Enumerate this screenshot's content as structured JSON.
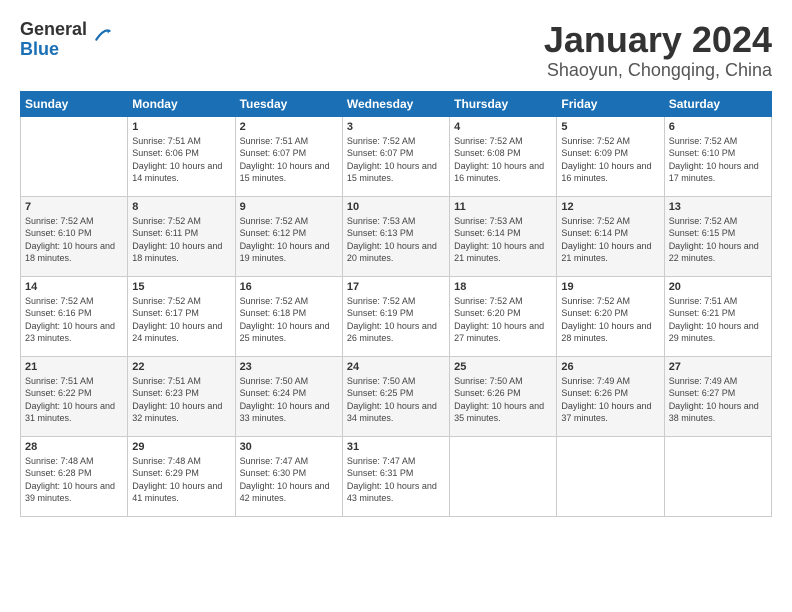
{
  "header": {
    "logo_general": "General",
    "logo_blue": "Blue",
    "title": "January 2024",
    "location": "Shaoyun, Chongqing, China"
  },
  "days_of_week": [
    "Sunday",
    "Monday",
    "Tuesday",
    "Wednesday",
    "Thursday",
    "Friday",
    "Saturday"
  ],
  "weeks": [
    [
      {
        "num": "",
        "sunrise": "",
        "sunset": "",
        "daylight": ""
      },
      {
        "num": "1",
        "sunrise": "Sunrise: 7:51 AM",
        "sunset": "Sunset: 6:06 PM",
        "daylight": "Daylight: 10 hours and 14 minutes."
      },
      {
        "num": "2",
        "sunrise": "Sunrise: 7:51 AM",
        "sunset": "Sunset: 6:07 PM",
        "daylight": "Daylight: 10 hours and 15 minutes."
      },
      {
        "num": "3",
        "sunrise": "Sunrise: 7:52 AM",
        "sunset": "Sunset: 6:07 PM",
        "daylight": "Daylight: 10 hours and 15 minutes."
      },
      {
        "num": "4",
        "sunrise": "Sunrise: 7:52 AM",
        "sunset": "Sunset: 6:08 PM",
        "daylight": "Daylight: 10 hours and 16 minutes."
      },
      {
        "num": "5",
        "sunrise": "Sunrise: 7:52 AM",
        "sunset": "Sunset: 6:09 PM",
        "daylight": "Daylight: 10 hours and 16 minutes."
      },
      {
        "num": "6",
        "sunrise": "Sunrise: 7:52 AM",
        "sunset": "Sunset: 6:10 PM",
        "daylight": "Daylight: 10 hours and 17 minutes."
      }
    ],
    [
      {
        "num": "7",
        "sunrise": "Sunrise: 7:52 AM",
        "sunset": "Sunset: 6:10 PM",
        "daylight": "Daylight: 10 hours and 18 minutes."
      },
      {
        "num": "8",
        "sunrise": "Sunrise: 7:52 AM",
        "sunset": "Sunset: 6:11 PM",
        "daylight": "Daylight: 10 hours and 18 minutes."
      },
      {
        "num": "9",
        "sunrise": "Sunrise: 7:52 AM",
        "sunset": "Sunset: 6:12 PM",
        "daylight": "Daylight: 10 hours and 19 minutes."
      },
      {
        "num": "10",
        "sunrise": "Sunrise: 7:53 AM",
        "sunset": "Sunset: 6:13 PM",
        "daylight": "Daylight: 10 hours and 20 minutes."
      },
      {
        "num": "11",
        "sunrise": "Sunrise: 7:53 AM",
        "sunset": "Sunset: 6:14 PM",
        "daylight": "Daylight: 10 hours and 21 minutes."
      },
      {
        "num": "12",
        "sunrise": "Sunrise: 7:52 AM",
        "sunset": "Sunset: 6:14 PM",
        "daylight": "Daylight: 10 hours and 21 minutes."
      },
      {
        "num": "13",
        "sunrise": "Sunrise: 7:52 AM",
        "sunset": "Sunset: 6:15 PM",
        "daylight": "Daylight: 10 hours and 22 minutes."
      }
    ],
    [
      {
        "num": "14",
        "sunrise": "Sunrise: 7:52 AM",
        "sunset": "Sunset: 6:16 PM",
        "daylight": "Daylight: 10 hours and 23 minutes."
      },
      {
        "num": "15",
        "sunrise": "Sunrise: 7:52 AM",
        "sunset": "Sunset: 6:17 PM",
        "daylight": "Daylight: 10 hours and 24 minutes."
      },
      {
        "num": "16",
        "sunrise": "Sunrise: 7:52 AM",
        "sunset": "Sunset: 6:18 PM",
        "daylight": "Daylight: 10 hours and 25 minutes."
      },
      {
        "num": "17",
        "sunrise": "Sunrise: 7:52 AM",
        "sunset": "Sunset: 6:19 PM",
        "daylight": "Daylight: 10 hours and 26 minutes."
      },
      {
        "num": "18",
        "sunrise": "Sunrise: 7:52 AM",
        "sunset": "Sunset: 6:20 PM",
        "daylight": "Daylight: 10 hours and 27 minutes."
      },
      {
        "num": "19",
        "sunrise": "Sunrise: 7:52 AM",
        "sunset": "Sunset: 6:20 PM",
        "daylight": "Daylight: 10 hours and 28 minutes."
      },
      {
        "num": "20",
        "sunrise": "Sunrise: 7:51 AM",
        "sunset": "Sunset: 6:21 PM",
        "daylight": "Daylight: 10 hours and 29 minutes."
      }
    ],
    [
      {
        "num": "21",
        "sunrise": "Sunrise: 7:51 AM",
        "sunset": "Sunset: 6:22 PM",
        "daylight": "Daylight: 10 hours and 31 minutes."
      },
      {
        "num": "22",
        "sunrise": "Sunrise: 7:51 AM",
        "sunset": "Sunset: 6:23 PM",
        "daylight": "Daylight: 10 hours and 32 minutes."
      },
      {
        "num": "23",
        "sunrise": "Sunrise: 7:50 AM",
        "sunset": "Sunset: 6:24 PM",
        "daylight": "Daylight: 10 hours and 33 minutes."
      },
      {
        "num": "24",
        "sunrise": "Sunrise: 7:50 AM",
        "sunset": "Sunset: 6:25 PM",
        "daylight": "Daylight: 10 hours and 34 minutes."
      },
      {
        "num": "25",
        "sunrise": "Sunrise: 7:50 AM",
        "sunset": "Sunset: 6:26 PM",
        "daylight": "Daylight: 10 hours and 35 minutes."
      },
      {
        "num": "26",
        "sunrise": "Sunrise: 7:49 AM",
        "sunset": "Sunset: 6:26 PM",
        "daylight": "Daylight: 10 hours and 37 minutes."
      },
      {
        "num": "27",
        "sunrise": "Sunrise: 7:49 AM",
        "sunset": "Sunset: 6:27 PM",
        "daylight": "Daylight: 10 hours and 38 minutes."
      }
    ],
    [
      {
        "num": "28",
        "sunrise": "Sunrise: 7:48 AM",
        "sunset": "Sunset: 6:28 PM",
        "daylight": "Daylight: 10 hours and 39 minutes."
      },
      {
        "num": "29",
        "sunrise": "Sunrise: 7:48 AM",
        "sunset": "Sunset: 6:29 PM",
        "daylight": "Daylight: 10 hours and 41 minutes."
      },
      {
        "num": "30",
        "sunrise": "Sunrise: 7:47 AM",
        "sunset": "Sunset: 6:30 PM",
        "daylight": "Daylight: 10 hours and 42 minutes."
      },
      {
        "num": "31",
        "sunrise": "Sunrise: 7:47 AM",
        "sunset": "Sunset: 6:31 PM",
        "daylight": "Daylight: 10 hours and 43 minutes."
      },
      {
        "num": "",
        "sunrise": "",
        "sunset": "",
        "daylight": ""
      },
      {
        "num": "",
        "sunrise": "",
        "sunset": "",
        "daylight": ""
      },
      {
        "num": "",
        "sunrise": "",
        "sunset": "",
        "daylight": ""
      }
    ]
  ]
}
